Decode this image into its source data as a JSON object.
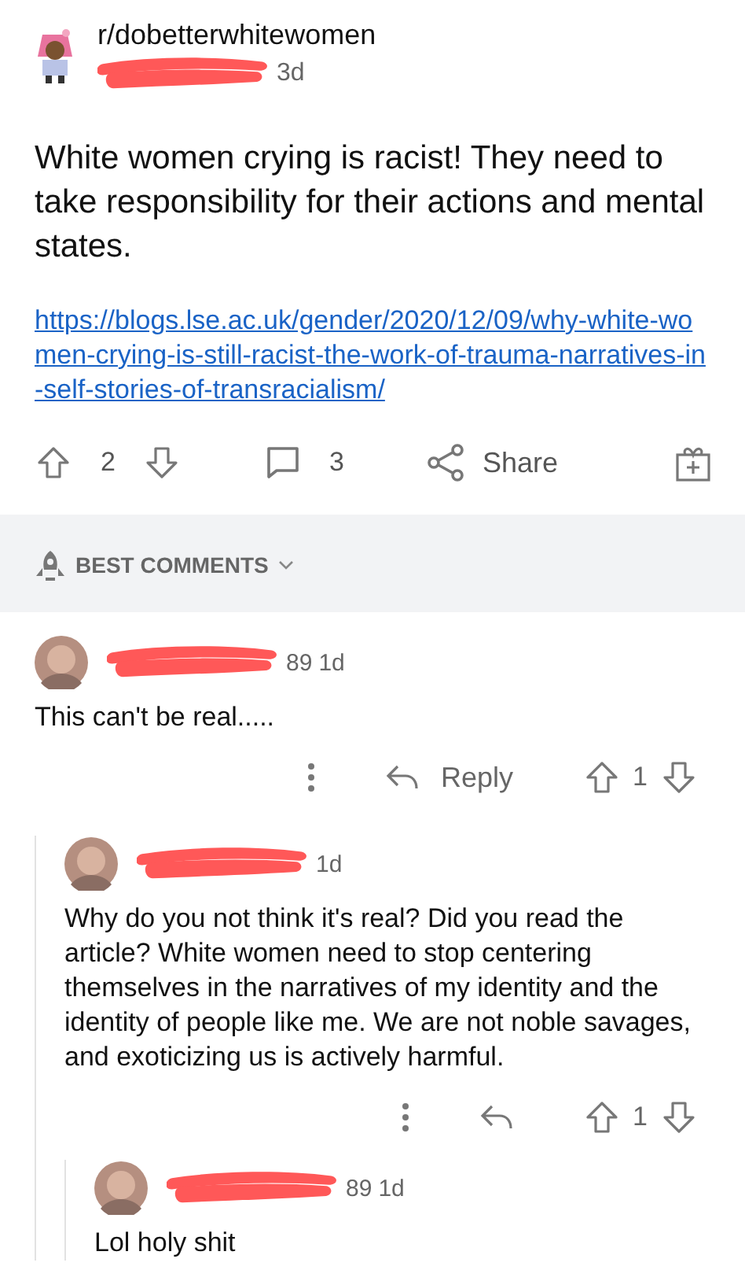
{
  "post": {
    "subreddit": "r/dobetterwhitewomen",
    "author": {
      "age": "3d"
    },
    "title": "White women crying is racist! They need to take responsibility for their actions and mental states.",
    "link": "https://blogs.lse.ac.uk/gender/2020/12/09/why-white-women-crying-is-still-racist-the-work-of-trauma-narratives-in-self-stories-of-transracialism/",
    "score": "2",
    "comments": "3",
    "share": "Share"
  },
  "sort": {
    "label": "BEST COMMENTS"
  },
  "comments": [
    {
      "author": {
        "visible_tail": "89",
        "age": "1d"
      },
      "body": "This can't be real.....",
      "reply_label": "Reply",
      "score": "1",
      "children": [
        {
          "author": {
            "age": "1d"
          },
          "body": "Why do you not think it's real?  Did you read the article? White women need to stop centering themselves in the narratives of my identity and the identity of people like me. We are not noble savages, and exoticizing us is actively harmful.",
          "score": "1",
          "children": [
            {
              "author": {
                "visible_tail": "89",
                "age": "1d"
              },
              "body": "Lol holy shit"
            }
          ]
        }
      ]
    }
  ]
}
